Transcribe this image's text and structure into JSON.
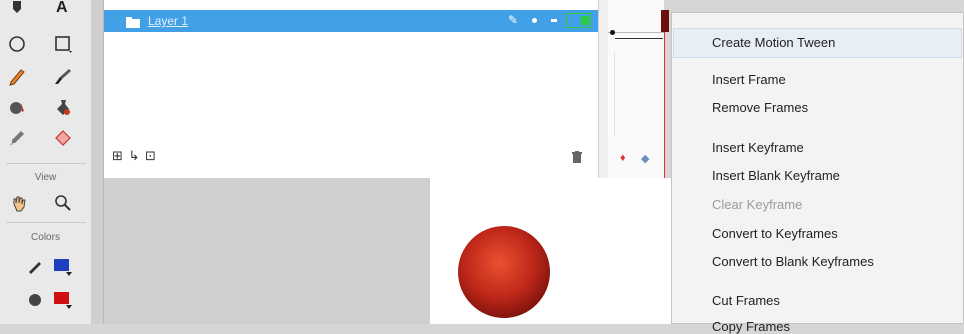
{
  "tools_panel": {
    "section_view": "View",
    "section_colors": "Colors",
    "tools": [
      "subselection-icon",
      "text-icon",
      "oval-icon",
      "rectangle-icon",
      "pencil-icon",
      "brush-icon",
      "paint-bucket-icon",
      "ink-bottle-icon",
      "eyedropper-icon",
      "eraser-icon",
      "hand-icon",
      "zoom-icon",
      "stroke-color-icon",
      "fill-color-icon"
    ],
    "stroke_color": "#1f3fbf",
    "fill_color": "#d01010"
  },
  "timeline": {
    "layer_name": "Layer 1",
    "layer_color": "#41a0e6",
    "outline_color": "#2ecc40",
    "bottom_icons": "⊞ ↳ ⊡"
  },
  "stage": {
    "ball_color": "#c0281a"
  },
  "context_menu": {
    "items": [
      {
        "label": "Create Motion Tween",
        "enabled": true
      },
      {
        "label": "Insert Frame",
        "enabled": true
      },
      {
        "label": "Remove Frames",
        "enabled": true
      },
      {
        "label": "Insert Keyframe",
        "enabled": true
      },
      {
        "label": "Insert Blank Keyframe",
        "enabled": true
      },
      {
        "label": "Clear Keyframe",
        "enabled": false
      },
      {
        "label": "Convert to Keyframes",
        "enabled": true
      },
      {
        "label": "Convert to Blank Keyframes",
        "enabled": true
      },
      {
        "label": "Cut Frames",
        "enabled": true
      },
      {
        "label": "Copy Frames",
        "enabled": true
      }
    ]
  }
}
